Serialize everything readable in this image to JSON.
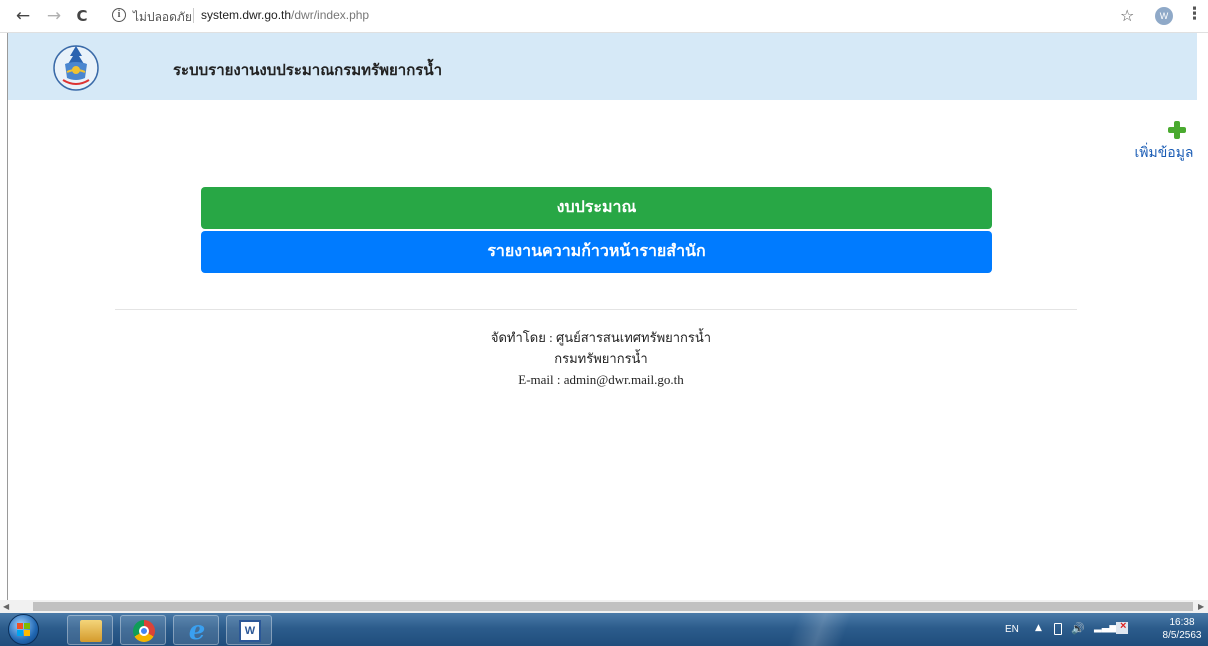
{
  "browser": {
    "back_icon": "←",
    "forward_icon": "→",
    "reload_icon": "C",
    "security_label": "ไม่ปลอดภัย",
    "url_host": "system.dwr.go.th",
    "url_path": "/dwr/index.php",
    "star_icon": "☆",
    "profile_initial": "W",
    "menu_icon": "⋮"
  },
  "site": {
    "title": "ระบบรายงานงบประมาณกรมทรัพยากรน้ำ",
    "add_label": "เพิ่มข้อมูล",
    "buttons": {
      "budget": "งบประมาณ",
      "report": "รายงานความก้าวหน้ารายสำนัก"
    },
    "footer": {
      "line1": "จัดทำโดย : ศูนย์สารสนเทศทรัพยากรน้ำ",
      "line2": "กรมทรัพยากรน้ำ",
      "line3": "E-mail : admin@dwr.mail.go.th"
    }
  },
  "scrollbar": {
    "left_arrow": "◀",
    "right_arrow": "▶"
  },
  "taskbar": {
    "word_glyph": "W",
    "ie_glyph": "e",
    "tray": {
      "lang": "EN",
      "up_arrow": "▲",
      "volume_icon": "🔊",
      "signal_icon": "▂▃▅"
    },
    "time": "16:38",
    "date": "8/5/2563"
  },
  "colors": {
    "header_bg": "#d6e9f7",
    "budget_btn": "#28a745",
    "report_btn": "#007bff",
    "add_icon": "#4aaa2f",
    "add_link": "#1a5cb5"
  }
}
